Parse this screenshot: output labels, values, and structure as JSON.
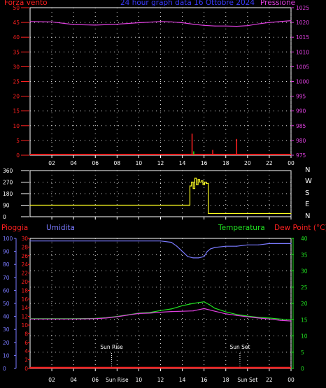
{
  "colors": {
    "red": "#ff2020",
    "blue": "#3a3aff",
    "magenta": "#e040e0",
    "yellow": "#ffff20",
    "green": "#20e020",
    "lightblue": "#7a7aff",
    "white": "#ffffff",
    "grid": "#dddddd"
  },
  "header": {
    "left": "Forza vento",
    "center": "24 hour graph data  16 Ottobre 2024",
    "right": "Pressione"
  },
  "lower_header": {
    "pioggia": "Pioggia",
    "umidita": "Umidita",
    "temperatura": "Temperatura",
    "dewpoint": "Dew Point (°C)"
  },
  "compass": [
    "N",
    "W",
    "S",
    "E",
    "N"
  ],
  "chart_data": [
    {
      "type": "line",
      "x_ticks": [
        "02",
        "04",
        "06",
        "08",
        "10",
        "12",
        "14",
        "16",
        "18",
        "20",
        "22",
        "00"
      ],
      "y_left_ticks": [
        "0",
        "5",
        "10",
        "15",
        "20",
        "25",
        "30",
        "35",
        "40",
        "45",
        "50"
      ],
      "y_right_ticks": [
        "975",
        "980",
        "985",
        "990",
        "995",
        "1000",
        "1005",
        "1010",
        "1015",
        "1020",
        "1025"
      ],
      "ylim_left": [
        0,
        50
      ],
      "ylim_right": [
        975,
        1025
      ],
      "series": [
        {
          "name": "Pressione",
          "color": "magenta",
          "axis": "right",
          "x": [
            0,
            2,
            4,
            6,
            8,
            10,
            12,
            13,
            14,
            15,
            16,
            17,
            18,
            19,
            20,
            21,
            22,
            23,
            24
          ],
          "y": [
            1020.3,
            1020.2,
            1019.3,
            1019.1,
            1019.4,
            1019.9,
            1020.3,
            1020.2,
            1019.9,
            1019.4,
            1019.0,
            1018.8,
            1018.8,
            1018.7,
            1018.9,
            1019.5,
            1020.0,
            1020.3,
            1020.6
          ]
        },
        {
          "name": "Forza vento",
          "color": "red",
          "axis": "left",
          "kind": "spikes",
          "x": [
            14.9,
            16.8,
            19.0
          ],
          "y": [
            7.3,
            1.8,
            5.5
          ]
        },
        {
          "color": "green",
          "axis": "left",
          "kind": "spikes",
          "x": [
            15.05
          ],
          "y": [
            1.3
          ]
        }
      ]
    },
    {
      "type": "line",
      "y_ticks": [
        "0",
        "90",
        "180",
        "270",
        "360"
      ],
      "ylim": [
        0,
        360
      ],
      "series": [
        {
          "color": "yellow",
          "kind": "step",
          "x": [
            0,
            14.6,
            14.7,
            14.85,
            15.0,
            15.15,
            15.3,
            15.45,
            15.6,
            15.75,
            15.9,
            16.05,
            16.2,
            16.4,
            24
          ],
          "y": [
            90,
            90,
            240,
            270,
            220,
            300,
            250,
            290,
            270,
            280,
            250,
            270,
            260,
            25,
            25
          ]
        }
      ]
    },
    {
      "type": "line",
      "x_ticks": [
        "02",
        "04",
        "06",
        "Sun Rise",
        "10",
        "12",
        "14",
        "16",
        "18",
        "Sun Set",
        "22",
        "00"
      ],
      "y_left_ticks": [
        "0",
        "10",
        "20",
        "30",
        "40",
        "50",
        "60",
        "70",
        "80",
        "90",
        "100"
      ],
      "y_mid_ticks": [
        "0",
        "2",
        "4",
        "6",
        "8",
        "10",
        "12",
        "14",
        "16",
        "18",
        "20",
        "22",
        "24",
        "26",
        "28",
        "30"
      ],
      "y_right_ticks": [
        "0",
        "5",
        "10",
        "15",
        "20",
        "25",
        "30",
        "35",
        "40"
      ],
      "ylim_humidity": [
        0,
        100
      ],
      "ylim_temperature": [
        0,
        40
      ],
      "annotations": [
        {
          "text": "Sun Rise",
          "x": 7.5
        },
        {
          "text": "Sun Set",
          "x": 19.3
        }
      ],
      "series": [
        {
          "name": "Umidita",
          "color": "lightblue",
          "axis": "humidity",
          "x": [
            0,
            2,
            4,
            6,
            8,
            10,
            12,
            13,
            13.5,
            14,
            14.5,
            15,
            15.5,
            16,
            16.3,
            16.6,
            17,
            18,
            19,
            20,
            21,
            22,
            23,
            24
          ],
          "y": [
            98,
            98,
            98,
            98,
            98,
            98,
            98,
            97,
            94,
            90,
            86,
            85,
            85,
            86,
            90,
            92,
            93,
            94,
            94,
            95,
            95,
            96,
            96,
            96
          ]
        },
        {
          "name": "Temperatura",
          "color": "green",
          "axis": "temperature",
          "x": [
            0,
            2,
            4,
            6,
            7,
            8,
            9,
            10,
            11,
            12,
            13,
            14,
            15,
            16,
            16.5,
            17,
            18,
            19,
            20,
            21,
            22,
            23,
            24
          ],
          "y": [
            15.3,
            15.3,
            15.3,
            15.4,
            15.6,
            16.0,
            16.5,
            17.0,
            17.2,
            17.8,
            18.3,
            19.3,
            20.0,
            20.5,
            19.6,
            18.5,
            17.4,
            16.6,
            16.1,
            15.7,
            15.5,
            15.2,
            15.0
          ]
        },
        {
          "name": "Dew Point",
          "color": "magenta",
          "axis": "temperature",
          "x": [
            0,
            2,
            4,
            6,
            7,
            8,
            9,
            10,
            11,
            12,
            13,
            14,
            15,
            16,
            17,
            18,
            19,
            20,
            21,
            22,
            23,
            24
          ],
          "y": [
            15.2,
            15.2,
            15.2,
            15.3,
            15.5,
            15.9,
            16.4,
            16.9,
            17.0,
            17.3,
            17.5,
            17.6,
            17.7,
            18.4,
            17.6,
            16.8,
            16.3,
            15.9,
            15.5,
            15.2,
            14.8,
            14.6
          ]
        },
        {
          "name": "Pioggia",
          "color": "red",
          "axis": "rain",
          "x": [
            0,
            24
          ],
          "y": [
            0,
            0
          ]
        }
      ]
    }
  ]
}
